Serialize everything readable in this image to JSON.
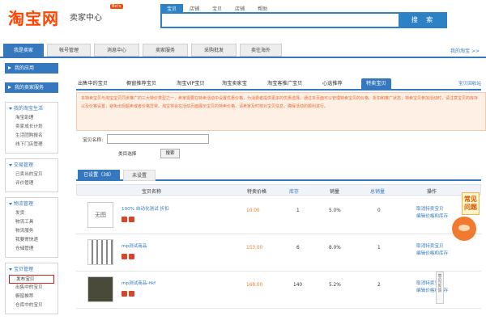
{
  "header": {
    "logo": "淘宝网",
    "logo_sub": "卖家中心",
    "beta": "Beta",
    "search_tabs": [
      "宝贝",
      "店铺",
      "宝贝",
      "店铺",
      "帮助"
    ],
    "search_button": "搜 索"
  },
  "nav": {
    "items": [
      "我是卖家",
      "帐号管理",
      "消息中心",
      "卖家服务",
      "采购批发",
      "卖往海外"
    ],
    "right_link": "我的淘宝 >>"
  },
  "sidebar": {
    "buttons": [
      "我的应用",
      "我的卖家服务"
    ],
    "groups": [
      {
        "title": "我的淘宝生活",
        "links": [
          "淘宝助理",
          "卖家成长计划",
          "生活团购报名",
          "线下门店管理"
        ]
      },
      {
        "title": "交易管理",
        "links": [
          "已卖出的宝贝",
          "评价管理"
        ]
      },
      {
        "title": "物流管理",
        "links": [
          "发货",
          "物流工具",
          "物流服务",
          "我要寄快递",
          "仓储管理"
        ]
      },
      {
        "title": "宝贝管理",
        "links": [
          "发布宝贝",
          "出售中的宝贝",
          "橱窗推荐",
          "仓库中的宝贝"
        ]
      }
    ]
  },
  "main": {
    "tabs": [
      "出售中的宝贝",
      "橱窗推荐宝贝",
      "淘宝VIP宝贝",
      "淘宝卖家宝",
      "淘宝客推广宝贝",
      "心选推荐",
      "特卖宝贝"
    ],
    "tabs_link": "宝贝回收站",
    "notice": "本特卖宝贝与淘宝宝贝同步推广的三大特价类型之一，卖家需要在特卖活动中设置优惠价格，为消费者提供更多的优惠选择。通过本页面可以管理特卖宝贝的价格、折扣和推广状态；特卖宝贝参加活动时，请注意宝贝的库存以及价格设置，避免出现超卖或者价格异常。淘宝将会在活动页面展示宝贝的特卖价格，请卖家及时核对宝贝信息，确保活动的顺利进行。",
    "form": {
      "label": "宝贝名称:",
      "input_value": "",
      "select": "类目选择",
      "search": "搜索"
    },
    "subtabs": [
      "已设置（38）",
      "未设置"
    ],
    "table": {
      "headers": [
        "宝贝名称",
        "特卖价格",
        "库存",
        "销量",
        "总销量",
        "操作"
      ],
      "rows": [
        {
          "thumb": "无图",
          "name": "100% 自动化测试 折扣",
          "price": "10.00",
          "stock": "1",
          "rate": "5.0%",
          "total": "0",
          "actions": [
            "取消特卖宝贝",
            "编辑价格和库存"
          ]
        },
        {
          "thumb": "",
          "name": "mp测试商品",
          "price": "153.00",
          "stock": "6",
          "rate": "8.0%",
          "total": "1",
          "actions": [
            "取消特卖宝贝",
            "编辑价格和库存"
          ]
        },
        {
          "thumb": "",
          "name": "mp测试商品-hkf",
          "price": "168.00",
          "stock": "140",
          "rate": "5.2%",
          "total": "2",
          "actions": [
            "取消特卖宝贝",
            "编辑价格和库存"
          ]
        }
      ]
    }
  },
  "widget": {
    "title": "常见问题",
    "feedback": "意见反馈"
  },
  "colors": {
    "primary": "#3578bd",
    "logo": "#ff4400",
    "notice_bg": "#fff0e6",
    "price": "#f07b30",
    "selected_border": "#d21b1b"
  }
}
